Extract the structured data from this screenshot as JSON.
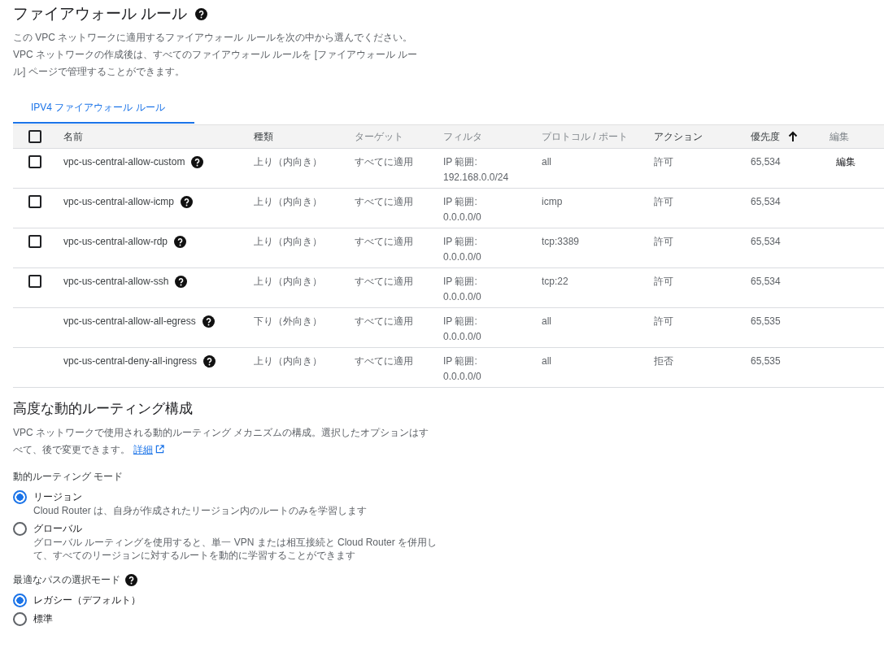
{
  "firewall": {
    "title": "ファイアウォール ルール",
    "description": "この VPC ネットワークに適用するファイアウォール ルールを次の中から選んでください。VPC ネットワークの作成後は、すべてのファイアウォール ルールを [ファイアウォール ルール] ページで管理することができます。",
    "tabs": [
      {
        "label": "IPV4 ファイアウォール ルール",
        "selected": true
      }
    ],
    "table": {
      "select_all": {
        "checked": false
      },
      "columns": [
        {
          "label": "名前",
          "sortable": true,
          "sorted": false
        },
        {
          "label": "種類",
          "sortable": true,
          "sorted": false
        },
        {
          "label": "ターゲット",
          "sortable": false,
          "sorted": false
        },
        {
          "label": "フィルタ",
          "sortable": false,
          "sorted": false
        },
        {
          "label": "プロトコル / ポート",
          "sortable": false,
          "sorted": false
        },
        {
          "label": "アクション",
          "sortable": true,
          "sorted": false
        },
        {
          "label": "優先度",
          "sortable": true,
          "sorted": true
        },
        {
          "label": "編集",
          "sortable": false,
          "sorted": false
        }
      ],
      "rows": [
        {
          "kind": "selectable",
          "checked": false,
          "name": "vpc-us-central-allow-custom",
          "type": "上り（内向き）",
          "target": "すべてに適用",
          "filter": [
            "IP 範囲:",
            "192.168.0.0/24"
          ],
          "protocol": "all",
          "action": "許可",
          "priority": "65,534",
          "edit": "編集"
        },
        {
          "kind": "selectable",
          "checked": false,
          "name": "vpc-us-central-allow-icmp",
          "type": "上り（内向き）",
          "target": "すべてに適用",
          "filter": [
            "IP 範囲:",
            "0.0.0.0/0"
          ],
          "protocol": "icmp",
          "action": "許可",
          "priority": "65,534"
        },
        {
          "kind": "selectable",
          "checked": false,
          "name": "vpc-us-central-allow-rdp",
          "type": "上り（内向き）",
          "target": "すべてに適用",
          "filter": [
            "IP 範囲:",
            "0.0.0.0/0"
          ],
          "protocol": "tcp:3389",
          "action": "許可",
          "priority": "65,534"
        },
        {
          "kind": "selectable",
          "checked": false,
          "name": "vpc-us-central-allow-ssh",
          "type": "上り（内向き）",
          "target": "すべてに適用",
          "filter": [
            "IP 範囲:",
            "0.0.0.0/0"
          ],
          "protocol": "tcp:22",
          "action": "許可",
          "priority": "65,534"
        },
        {
          "kind": "fixed",
          "name": "vpc-us-central-allow-all-egress",
          "type": "下り（外向き）",
          "target": "すべてに適用",
          "filter": [
            "IP 範囲:",
            "0.0.0.0/0"
          ],
          "protocol": "all",
          "action": "許可",
          "priority": "65,535"
        },
        {
          "kind": "fixed",
          "name": "vpc-us-central-deny-all-ingress",
          "type": "上り（内向き）",
          "target": "すべてに適用",
          "filter": [
            "IP 範囲:",
            "0.0.0.0/0"
          ],
          "protocol": "all",
          "action": "拒否",
          "priority": "65,535"
        }
      ]
    }
  },
  "routing": {
    "title": "高度な動的ルーティング構成",
    "description": "VPC ネットワークで使用される動的ルーティング メカニズムの構成。選択したオプションはすべて、後で変更できます。",
    "link": "詳細",
    "groups": [
      {
        "label": "動的ルーティング モード",
        "help": false,
        "options": [
          {
            "label": "リージョン",
            "description": "Cloud Router は、自身が作成されたリージョン内のルートのみを学習します",
            "selected": true
          },
          {
            "label": "グローバル",
            "description": "グローバル ルーティングを使用すると、単一 VPN または相互接続と Cloud Router を併用して、すべてのリージョンに対するルートを動的に学習することができます",
            "selected": false
          }
        ]
      },
      {
        "label": "最適なパスの選択モード",
        "help": true,
        "options": [
          {
            "label": "レガシー（デフォルト）",
            "selected": true
          },
          {
            "label": "標準",
            "selected": false
          }
        ]
      }
    ]
  }
}
